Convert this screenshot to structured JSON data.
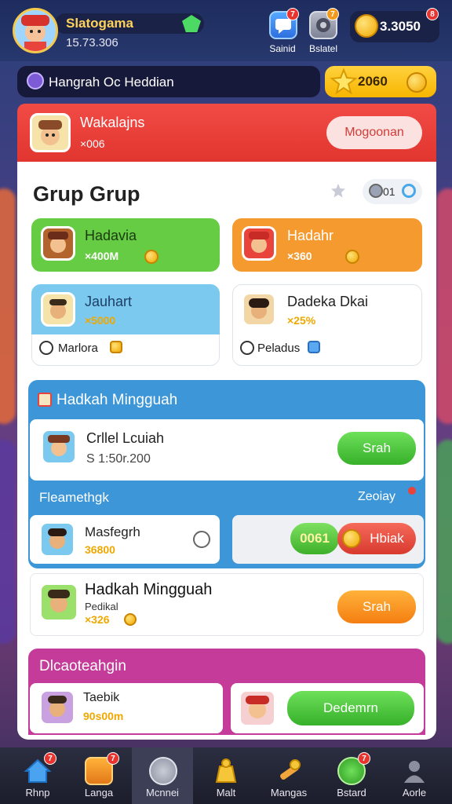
{
  "header": {
    "player_name": "Slatogama",
    "player_id": "15.73.306",
    "top_buttons": [
      {
        "label": "Sainid",
        "badge": "7"
      },
      {
        "label": "Bslatel",
        "badge": "7"
      }
    ],
    "coins": "3.3050",
    "coins_badge": "8"
  },
  "search": {
    "text": "Hangrah Oc Heddian",
    "stars": "2060"
  },
  "banner": {
    "title": "Wakalajns",
    "sub": "×006",
    "button": "Mogoonan"
  },
  "group": {
    "title": "Grup Grup",
    "controls_text": "01",
    "cards": [
      {
        "title": "Hadavia",
        "value": "×400M",
        "color": "#6ccf45"
      },
      {
        "title": "Hadahr",
        "value": "×360",
        "color": "#f59a2f"
      },
      {
        "title": "Jauhart",
        "value": "×5000",
        "footer": "Marlora",
        "color": "#7cc9f0"
      },
      {
        "title": "Dadeka Dkai",
        "value": "×25%",
        "footer": "Peladus",
        "color": "#ffffff"
      }
    ]
  },
  "weekly": {
    "title": "Hadkah Mingguah",
    "row1": {
      "title": "Crllel Lcuiah",
      "sub": "S 1:50r.200",
      "button": "Srah"
    },
    "subheader_left": "Fleamethgk",
    "subheader_right": "Zeoiay",
    "row2": {
      "title": "Masfegrh",
      "value": "36800",
      "chip1": "0061",
      "chip2": "Hbiak"
    },
    "row3": {
      "title": "Hadkah Mingguah",
      "line2": "Pedikal",
      "value": "×326",
      "button": "Srah"
    }
  },
  "bottom_section": {
    "title": "Dlcaoteahgin",
    "item1": {
      "title": "Taebik",
      "value": "90s00m"
    },
    "item2": {
      "button": "Dedemrn"
    }
  },
  "nav": [
    {
      "label": "Rhnp",
      "badge": "7"
    },
    {
      "label": "Langa",
      "badge": "7"
    },
    {
      "label": "Mcnnei"
    },
    {
      "label": "Malt"
    },
    {
      "label": "Mangas"
    },
    {
      "label": "Bstard",
      "badge": "7"
    },
    {
      "label": "Aorle"
    }
  ],
  "colors": {
    "accent_green": "#5cc64a",
    "accent_orange": "#f7952b",
    "accent_red": "#e1342e",
    "accent_blue": "#3c96d8",
    "accent_pink": "#c43b9a"
  }
}
